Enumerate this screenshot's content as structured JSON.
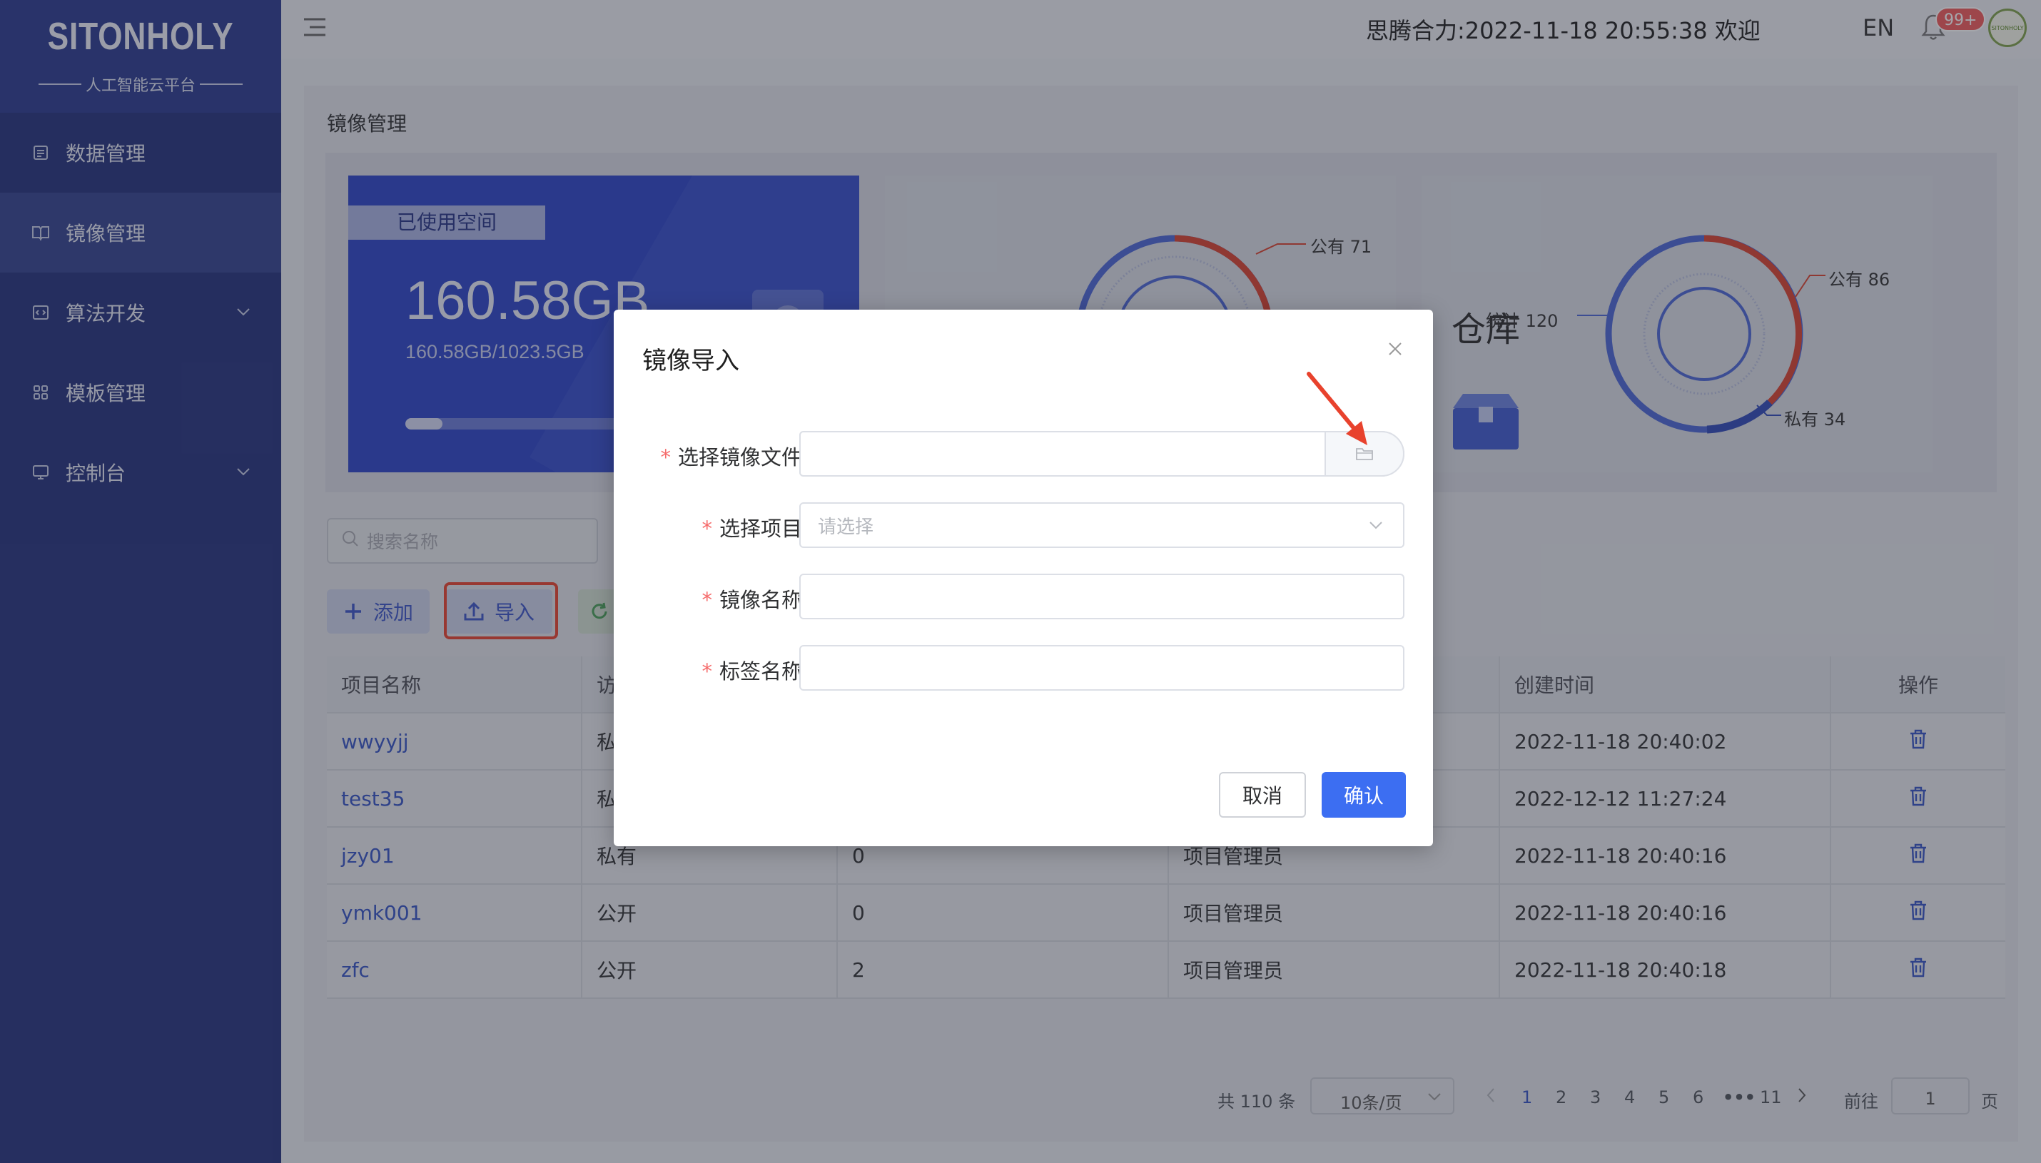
{
  "app": {
    "logo": "SITONHOLY",
    "logo_sub": "人工智能云平台"
  },
  "sidebar": {
    "items": [
      {
        "label": "数据管理",
        "icon": "list-icon",
        "active": false,
        "expandable": false
      },
      {
        "label": "镜像管理",
        "icon": "book-icon",
        "active": true,
        "expandable": false
      },
      {
        "label": "算法开发",
        "icon": "code-icon",
        "active": false,
        "expandable": true
      },
      {
        "label": "模板管理",
        "icon": "grid-icon",
        "active": false,
        "expandable": false
      },
      {
        "label": "控制台",
        "icon": "monitor-icon",
        "active": false,
        "expandable": true
      }
    ]
  },
  "header": {
    "welcome": "思腾合力:2022-11-18 20:55:38 欢迎",
    "lang": "EN",
    "badge": "99+",
    "avatar_text": "SITONHOLY"
  },
  "main": {
    "title": "镜像管理",
    "storage": {
      "tag": "已使用空间",
      "used": "160.58GB",
      "ratio": "160.58GB/1023.5GB",
      "used_fraction": 0.157
    },
    "chart1": {
      "public_label": "公有 71"
    },
    "chart2": {
      "title": "仓库",
      "total_label": "统计 120",
      "public_label": "公有 86",
      "private_label": "私有 34"
    },
    "search_placeholder": "搜索名称",
    "add_label": "添加",
    "import_label": "导入"
  },
  "table": {
    "headers": [
      "项目名称",
      "访",
      "",
      "",
      "创建时间",
      "操作"
    ],
    "rows": [
      {
        "name": "wwyyjj",
        "access": "私",
        "count": "",
        "role": "",
        "created": "2022-11-18 20:40:02"
      },
      {
        "name": "test35",
        "access": "私",
        "count": "",
        "role": "",
        "created": "2022-12-12 11:27:24"
      },
      {
        "name": "jzy01",
        "access": "私有",
        "count": "0",
        "role": "项目管理员",
        "created": "2022-11-18 20:40:16"
      },
      {
        "name": "ymk001",
        "access": "公开",
        "count": "0",
        "role": "项目管理员",
        "created": "2022-11-18 20:40:16"
      },
      {
        "name": "zfc",
        "access": "公开",
        "count": "2",
        "role": "项目管理员",
        "created": "2022-11-18 20:40:18"
      }
    ]
  },
  "pager": {
    "total": "共 110 条",
    "page_size": "10条/页",
    "pages": [
      "1",
      "2",
      "3",
      "4",
      "5",
      "6"
    ],
    "ellipsis": "•••",
    "last": "11",
    "goto_label": "前往",
    "goto_value": "1",
    "page_suffix": "页"
  },
  "modal": {
    "title": "镜像导入",
    "fields": [
      {
        "label": "选择镜像文件",
        "value": "",
        "placeholder": ""
      },
      {
        "label": "选择项目",
        "value": "",
        "placeholder": "请选择"
      },
      {
        "label": "镜像名称",
        "value": "",
        "placeholder": ""
      },
      {
        "label": "标签名称",
        "value": "",
        "placeholder": ""
      }
    ],
    "cancel": "取消",
    "confirm": "确认"
  },
  "colors": {
    "sidebar": "#24317d",
    "primary": "#3c6ef2",
    "annotation": "#e8422d"
  }
}
